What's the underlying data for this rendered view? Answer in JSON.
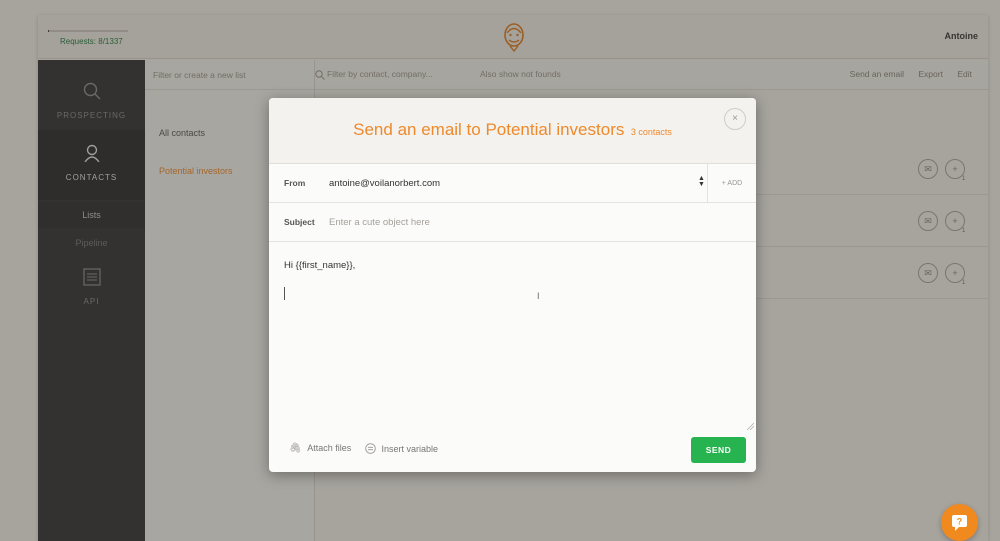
{
  "topbar": {
    "requests_label": "Requests: 8/1337",
    "requests_progress": 0.006,
    "username": "Antoine"
  },
  "sidebar": {
    "items": [
      {
        "label": "PROSPECTING",
        "icon": "search-icon"
      },
      {
        "label": "CONTACTS",
        "icon": "person-icon"
      },
      {
        "label": "Lists"
      },
      {
        "label": "Pipeline"
      },
      {
        "label": "API",
        "icon": "settings-sliders-icon"
      }
    ]
  },
  "lists": {
    "filter_placeholder": "Filter or create a new list",
    "items": [
      {
        "label": "All contacts"
      },
      {
        "label": "Potential investors",
        "color": "#ee8a2b"
      }
    ]
  },
  "main": {
    "filter_placeholder": "Filter by contact, company...",
    "also_show": "Also show not founds",
    "actions": [
      "Send an email",
      "Export",
      "Edit"
    ],
    "row_counts": [
      "1",
      "1",
      "1"
    ]
  },
  "modal": {
    "title": "Send an email to Potential investors",
    "count": "3 contacts",
    "close_glyph": "×",
    "from_label": "From",
    "from_value": "antoine@voilanorbert.com",
    "add_label": "+ ADD",
    "subject_label": "Subject",
    "subject_placeholder": "Enter a cute object here",
    "body_text": "Hi {{first_name}},",
    "attach_label": "Attach files",
    "insert_label": "Insert variable",
    "send_label": "SEND"
  },
  "colors": {
    "accent": "#ee8a2b",
    "send": "#27b34f",
    "help": "#f18a1e"
  }
}
